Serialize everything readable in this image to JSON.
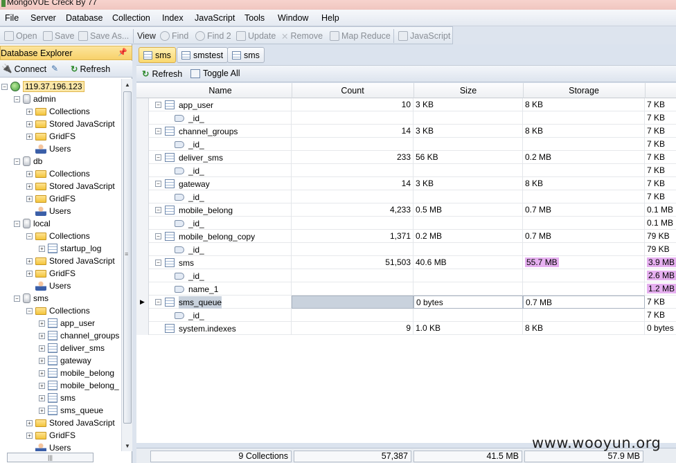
{
  "window": {
    "title": "MongoVUE Creck By 77"
  },
  "menu": [
    "File",
    "Server",
    "Database",
    "Collection",
    "Index",
    "JavaScript",
    "Tools",
    "Window",
    "Help"
  ],
  "toolbar": {
    "open": "Open",
    "save": "Save",
    "save_as": "Save As...",
    "view": "View",
    "find": "Find",
    "find2": "Find 2",
    "update": "Update",
    "remove": "Remove",
    "map_reduce": "Map Reduce",
    "javascript": "JavaScript"
  },
  "explorer": {
    "title": "Database Explorer",
    "connect": "Connect",
    "refresh": "Refresh",
    "server": "119.37.196.123",
    "nodes": {
      "admin": "admin",
      "db": "db",
      "local": "local",
      "sms": "sms",
      "collections": "Collections",
      "stored_js": "Stored JavaScript",
      "gridfs": "GridFS",
      "users": "Users",
      "startup_log": "startup_log",
      "sms_collections": [
        "app_user",
        "channel_groups",
        "deliver_sms",
        "gateway",
        "mobile_belong",
        "mobile_belong_",
        "sms",
        "sms_queue"
      ]
    }
  },
  "tabs": [
    "sms",
    "smstest",
    "sms"
  ],
  "subbar": {
    "refresh": "Refresh",
    "toggle_all": "Toggle All"
  },
  "grid": {
    "columns": [
      "Name",
      "Count",
      "Size",
      "Storage"
    ],
    "rows": [
      {
        "kind": "coll",
        "name": "app_user",
        "count": "10",
        "size": "3 KB",
        "storage": "8 KB",
        "extra": "7 KB"
      },
      {
        "kind": "idx",
        "name": "_id_",
        "extra": "7 KB"
      },
      {
        "kind": "coll",
        "name": "channel_groups",
        "count": "14",
        "size": "3 KB",
        "storage": "8 KB",
        "extra": "7 KB"
      },
      {
        "kind": "idx",
        "name": "_id_",
        "extra": "7 KB"
      },
      {
        "kind": "coll",
        "name": "deliver_sms",
        "count": "233",
        "size": "56 KB",
        "storage": "0.2 MB",
        "extra": "7 KB"
      },
      {
        "kind": "idx",
        "name": "_id_",
        "extra": "7 KB"
      },
      {
        "kind": "coll",
        "name": "gateway",
        "count": "14",
        "size": "3 KB",
        "storage": "8 KB",
        "extra": "7 KB"
      },
      {
        "kind": "idx",
        "name": "_id_",
        "extra": "7 KB"
      },
      {
        "kind": "coll",
        "name": "mobile_belong",
        "count": "4,233",
        "size": "0.5 MB",
        "storage": "0.7 MB",
        "extra": "0.1 MB"
      },
      {
        "kind": "idx",
        "name": "_id_",
        "extra": "0.1 MB"
      },
      {
        "kind": "coll",
        "name": "mobile_belong_copy",
        "count": "1,371",
        "size": "0.2 MB",
        "storage": "0.7 MB",
        "extra": "79 KB"
      },
      {
        "kind": "idx",
        "name": "_id_",
        "extra": "79 KB"
      },
      {
        "kind": "coll",
        "name": "sms",
        "count": "51,503",
        "size": "40.6 MB",
        "storage": "55.7 MB",
        "extra": "3.9 MB"
      },
      {
        "kind": "idx",
        "name": "_id_",
        "extra": "2.6 MB"
      },
      {
        "kind": "idx",
        "name": "name_1",
        "extra": "1.2 MB"
      },
      {
        "kind": "coll",
        "name": "sms_queue",
        "count": "",
        "size": "0 bytes",
        "storage": "0.7 MB",
        "extra": "7 KB"
      },
      {
        "kind": "idx",
        "name": "_id_",
        "extra": "7 KB"
      },
      {
        "kind": "sys",
        "name": "system.indexes",
        "count": "9",
        "size": "1.0 KB",
        "storage": "8 KB",
        "extra": "0 bytes"
      }
    ]
  },
  "footer": {
    "collections": "9 Collections",
    "count": "57,387",
    "size": "41.5 MB",
    "storage": "57.9 MB"
  },
  "watermark": "www.wooyun.org",
  "colors": {
    "highlight": "#e6b0f0",
    "active_tab": "#fad86f",
    "selection": "#c9d2dd"
  }
}
